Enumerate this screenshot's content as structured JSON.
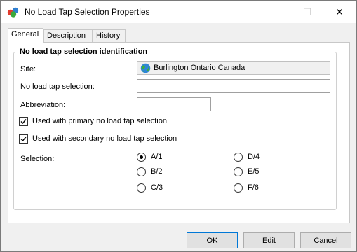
{
  "window": {
    "title": "No Load Tap Selection Properties",
    "controls": {
      "minimize": "—",
      "maximize": "☐",
      "close": "✕"
    }
  },
  "tabs": [
    {
      "label": "General",
      "active": true
    },
    {
      "label": "Description",
      "active": false
    },
    {
      "label": "History",
      "active": false
    }
  ],
  "group": {
    "title": "No load tap selection identification",
    "site_label": "Site:",
    "site_value": "Burlington Ontario Canada",
    "selection_name_label": "No load tap selection:",
    "selection_name_value": "",
    "abbreviation_label": "Abbreviation:",
    "abbreviation_value": "",
    "primary_checkbox_label": "Used with primary no load tap selection",
    "primary_checked": true,
    "secondary_checkbox_label": "Used with secondary no load tap selection",
    "secondary_checked": true,
    "selection_label": "Selection:",
    "options": [
      {
        "label": "A/1",
        "selected": true
      },
      {
        "label": "B/2",
        "selected": false
      },
      {
        "label": "C/3",
        "selected": false
      },
      {
        "label": "D/4",
        "selected": false
      },
      {
        "label": "E/5",
        "selected": false
      },
      {
        "label": "F/6",
        "selected": false
      }
    ]
  },
  "buttons": {
    "ok": "OK",
    "edit": "Edit",
    "cancel": "Cancel"
  },
  "colors": {
    "accent": "#0078d7",
    "panel": "#ffffff",
    "chrome": "#f0f0f0"
  }
}
